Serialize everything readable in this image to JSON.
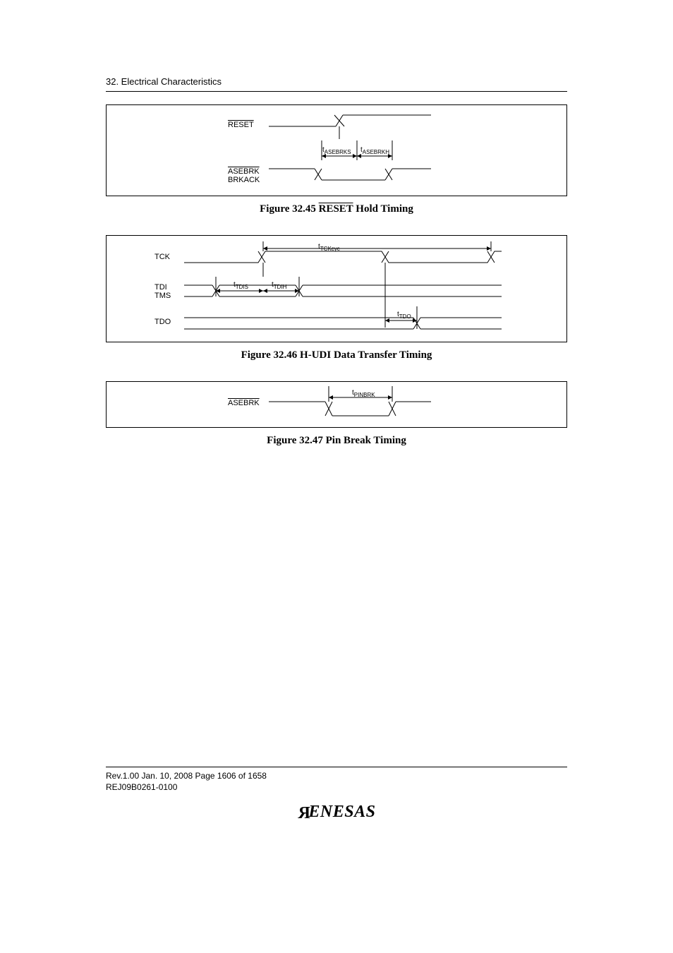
{
  "section_header": "32.   Electrical Characteristics",
  "fig45": {
    "caption_prefix": "Figure 32.45   ",
    "caption_signal": "RESET",
    "caption_suffix": " Hold Timing",
    "sig_reset": "RESET",
    "sig_asebrk": "ASEBRK",
    "sig_brkack": "BRKACK",
    "t_asebrks": "ASEBRKS",
    "t_asebrkh": "ASEBRKH"
  },
  "fig46": {
    "caption": "Figure 32.46   H-UDI Data Transfer Timing",
    "sig_tck": "TCK",
    "sig_tdi": "TDI",
    "sig_tms": "TMS",
    "sig_tdo": "TDO",
    "t_tckcyc": "TCKcyc",
    "t_tdis": "TDIS",
    "t_tdih": "TDIH",
    "t_tdo": "TDO"
  },
  "fig47": {
    "caption": "Figure 32.47   Pin Break Timing",
    "sig_asebrk": "ASEBRK",
    "t_pinbrk": "PINBRK"
  },
  "footer": {
    "line1": "Rev.1.00  Jan. 10, 2008  Page 1606 of 1658",
    "line2": "REJ09B0261-0100",
    "logo_rest": "ENESAS"
  }
}
